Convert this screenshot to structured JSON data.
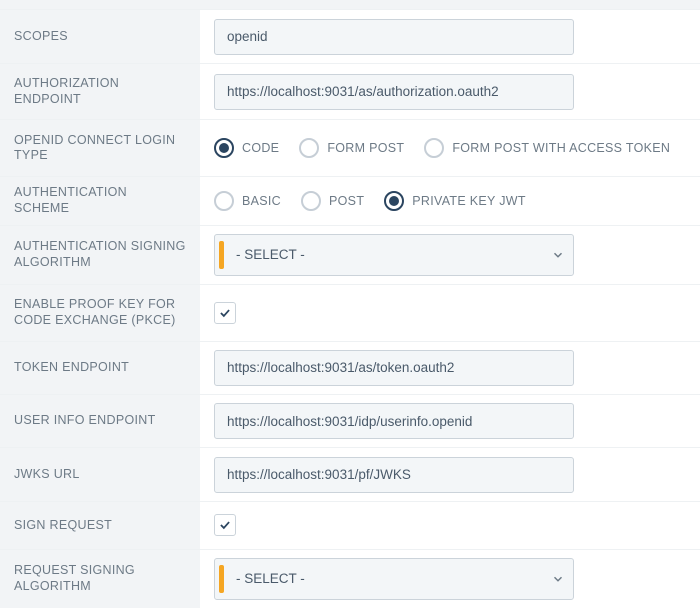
{
  "labels": {
    "scopes": "SCOPES",
    "authz_endpoint": "AUTHORIZATION ENDPOINT",
    "login_type": "OPENID CONNECT LOGIN TYPE",
    "auth_scheme": "AUTHENTICATION SCHEME",
    "auth_sign_algo": "AUTHENTICATION SIGNING ALGORITHM",
    "pkce": "ENABLE PROOF KEY FOR CODE EXCHANGE (PKCE)",
    "token_endpoint": "TOKEN ENDPOINT",
    "userinfo_endpoint": "USER INFO ENDPOINT",
    "jwks_url": "JWKS URL",
    "sign_request": "SIGN REQUEST",
    "req_sign_algo": "REQUEST SIGNING ALGORITHM"
  },
  "values": {
    "scopes": "openid",
    "authz_endpoint": "https://localhost:9031/as/authorization.oauth2",
    "token_endpoint": "https://localhost:9031/as/token.oauth2",
    "userinfo_endpoint": "https://localhost:9031/idp/userinfo.openid",
    "jwks_url": "https://localhost:9031/pf/JWKS",
    "auth_sign_algo_selected": "- SELECT -",
    "req_sign_algo_selected": "- SELECT -",
    "pkce_checked": true,
    "sign_request_checked": true,
    "login_type_selected": "CODE",
    "auth_scheme_selected": "PRIVATE_KEY_JWT"
  },
  "login_type_options": [
    {
      "key": "CODE",
      "label": "CODE"
    },
    {
      "key": "FORM_POST",
      "label": "FORM POST"
    },
    {
      "key": "FORM_POST_AT",
      "label": "FORM POST WITH ACCESS TOKEN"
    }
  ],
  "auth_scheme_options": [
    {
      "key": "BASIC",
      "label": "BASIC"
    },
    {
      "key": "POST",
      "label": "POST"
    },
    {
      "key": "PRIVATE_KEY_JWT",
      "label": "PRIVATE KEY JWT"
    }
  ],
  "colors": {
    "row_bg": "#f2f4f6",
    "input_bg": "#f3f6f8",
    "border": "#cbd3da",
    "text": "#4a5a6a",
    "radio_selected": "#2b4560",
    "accent_orange": "#f5a623"
  }
}
